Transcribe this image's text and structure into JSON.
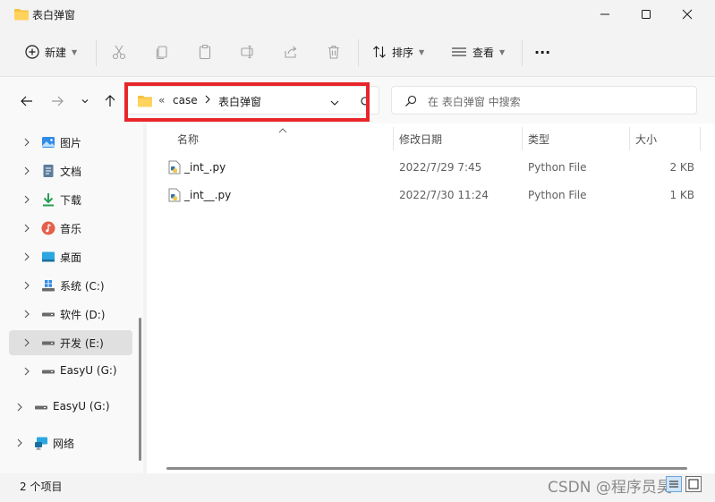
{
  "window": {
    "title": "表白弹窗"
  },
  "toolbar": {
    "new_label": "新建",
    "sort_label": "排序",
    "view_label": "查看",
    "more_label": "···"
  },
  "address": {
    "overflow": "«",
    "crumbs": [
      "case",
      "表白弹窗"
    ]
  },
  "search": {
    "placeholder": "在 表白弹窗 中搜索"
  },
  "sidebar": {
    "items": [
      {
        "label": "图片",
        "icon": "pictures-icon"
      },
      {
        "label": "文档",
        "icon": "documents-icon"
      },
      {
        "label": "下载",
        "icon": "downloads-icon"
      },
      {
        "label": "音乐",
        "icon": "music-icon"
      },
      {
        "label": "桌面",
        "icon": "desktop-icon"
      },
      {
        "label": "系统 (C:)",
        "icon": "system-drive-icon"
      },
      {
        "label": "软件 (D:)",
        "icon": "drive-icon"
      },
      {
        "label": "开发 (E:)",
        "icon": "drive-icon",
        "selected": true
      },
      {
        "label": "EasyU (G:)",
        "icon": "drive-icon"
      },
      {
        "label": "EasyU (G:)",
        "icon": "drive-icon"
      },
      {
        "label": "网络",
        "icon": "network-icon"
      }
    ]
  },
  "table": {
    "columns": [
      "名称",
      "修改日期",
      "类型",
      "大小"
    ],
    "rows": [
      {
        "name": "_int_.py",
        "modified": "2022/7/29 7:45",
        "type": "Python File",
        "size": "2 KB"
      },
      {
        "name": "_int__.py",
        "modified": "2022/7/30 11:24",
        "type": "Python File",
        "size": "1 KB"
      }
    ]
  },
  "status": {
    "count_text": "2 个项目"
  },
  "watermark": "CSDN @程序员昊",
  "colors": {
    "highlight": "#e8262a",
    "folder": "#f5c242",
    "accent": "#0067c0"
  }
}
